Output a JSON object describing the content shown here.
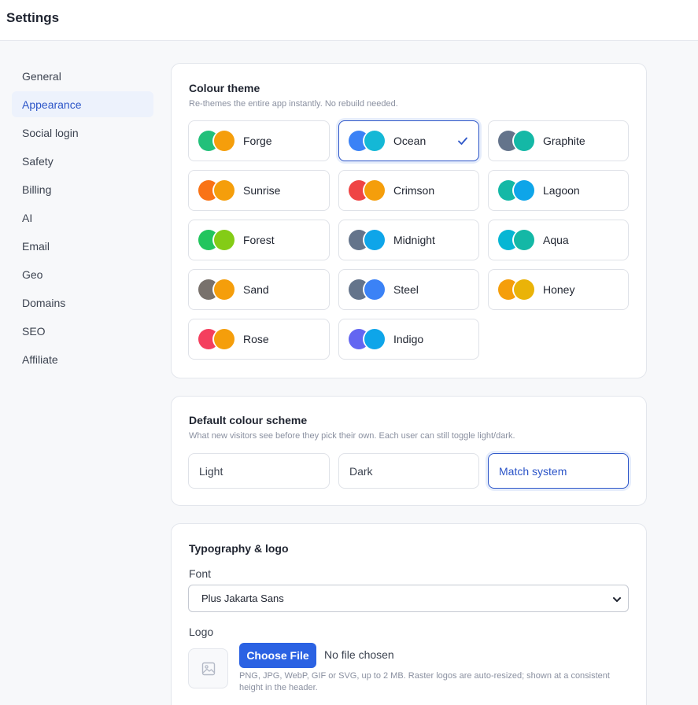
{
  "header": {
    "title": "Settings"
  },
  "sidebar": {
    "items": [
      {
        "label": "General"
      },
      {
        "label": "Appearance",
        "active": true
      },
      {
        "label": "Social login"
      },
      {
        "label": "Safety"
      },
      {
        "label": "Billing"
      },
      {
        "label": "AI"
      },
      {
        "label": "Email"
      },
      {
        "label": "Geo"
      },
      {
        "label": "Domains"
      },
      {
        "label": "SEO"
      },
      {
        "label": "Affiliate"
      }
    ]
  },
  "colour_theme": {
    "title": "Colour theme",
    "subtitle": "Re-themes the entire app instantly. No rebuild needed.",
    "selected": "Ocean",
    "themes": [
      {
        "label": "Forge",
        "colors": [
          "#22c07a",
          "#f59e0b"
        ]
      },
      {
        "label": "Ocean",
        "colors": [
          "#3b82f6",
          "#14b8d6"
        ]
      },
      {
        "label": "Graphite",
        "colors": [
          "#64748b",
          "#14b8a6"
        ]
      },
      {
        "label": "Sunrise",
        "colors": [
          "#f97316",
          "#f59e0b"
        ]
      },
      {
        "label": "Crimson",
        "colors": [
          "#ef4444",
          "#f59e0b"
        ]
      },
      {
        "label": "Lagoon",
        "colors": [
          "#14b8a6",
          "#0ea5e9"
        ]
      },
      {
        "label": "Forest",
        "colors": [
          "#22c55e",
          "#84cc16"
        ]
      },
      {
        "label": "Midnight",
        "colors": [
          "#64748b",
          "#0ea5e9"
        ]
      },
      {
        "label": "Aqua",
        "colors": [
          "#06b6d4",
          "#14b8a6"
        ]
      },
      {
        "label": "Sand",
        "colors": [
          "#78716c",
          "#f59e0b"
        ]
      },
      {
        "label": "Steel",
        "colors": [
          "#64748b",
          "#3b82f6"
        ]
      },
      {
        "label": "Honey",
        "colors": [
          "#f59e0b",
          "#eab308"
        ]
      },
      {
        "label": "Rose",
        "colors": [
          "#f43f5e",
          "#f59e0b"
        ]
      },
      {
        "label": "Indigo",
        "colors": [
          "#6366f1",
          "#0ea5e9"
        ]
      }
    ]
  },
  "colour_scheme": {
    "title": "Default colour scheme",
    "subtitle": "What new visitors see before they pick their own. Each user can still toggle light/dark.",
    "options": [
      {
        "label": "Light"
      },
      {
        "label": "Dark"
      },
      {
        "label": "Match system",
        "selected": true
      }
    ]
  },
  "typography": {
    "title": "Typography & logo",
    "font_label": "Font",
    "font_value": "Plus Jakarta Sans",
    "logo_label": "Logo",
    "choose_file_label": "Choose File",
    "file_status": "No file chosen",
    "hint": "PNG, JPG, WebP, GIF or SVG, up to 2 MB. Raster logos are auto-resized; shown at a consistent height in the header."
  },
  "icons": {
    "selected_check": "check-icon",
    "select_caret": "chevron-down-icon",
    "logo_placeholder": "image-icon"
  },
  "accent_color": "#2c55c8"
}
